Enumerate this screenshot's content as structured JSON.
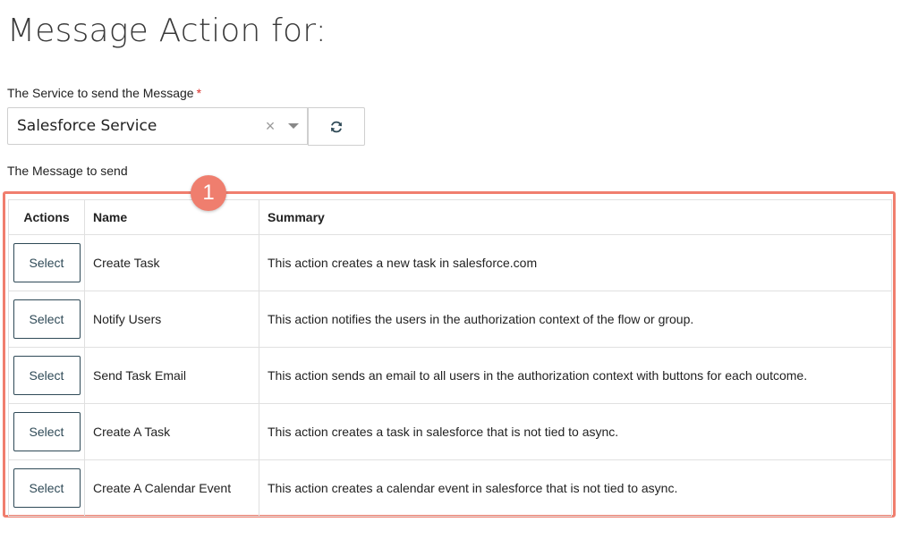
{
  "page": {
    "title": "Message Action for:"
  },
  "service": {
    "label": "The Service to send the Message",
    "required_marker": "*",
    "selected_value": "Salesforce Service",
    "clear_glyph": "×"
  },
  "message": {
    "label": "The Message to send"
  },
  "callout": {
    "number": "1",
    "color": "#ef7e6e"
  },
  "table": {
    "headers": {
      "actions": "Actions",
      "name": "Name",
      "summary": "Summary"
    },
    "rows": [
      {
        "action_label": "Select",
        "name": "Create Task",
        "summary": "This action creates a new task in salesforce.com"
      },
      {
        "action_label": "Select",
        "name": "Notify Users",
        "summary": "This action notifies the users in the authorization context of the flow or group."
      },
      {
        "action_label": "Select",
        "name": "Send Task Email",
        "summary": "This action sends an email to all users in the authorization context with buttons for each outcome."
      },
      {
        "action_label": "Select",
        "name": "Create A Task",
        "summary": "This action creates a task in salesforce that is not tied to async."
      },
      {
        "action_label": "Select",
        "name": "Create A Calendar Event",
        "summary": "This action creates a calendar event in salesforce that is not tied to async."
      }
    ]
  },
  "icons": {
    "refresh": "refresh-icon",
    "clear": "close-icon",
    "dropdown": "chevron-down-icon"
  },
  "colors": {
    "highlight": "#f07e6e",
    "button_border": "#2f4a57",
    "required": "#d9302b"
  }
}
